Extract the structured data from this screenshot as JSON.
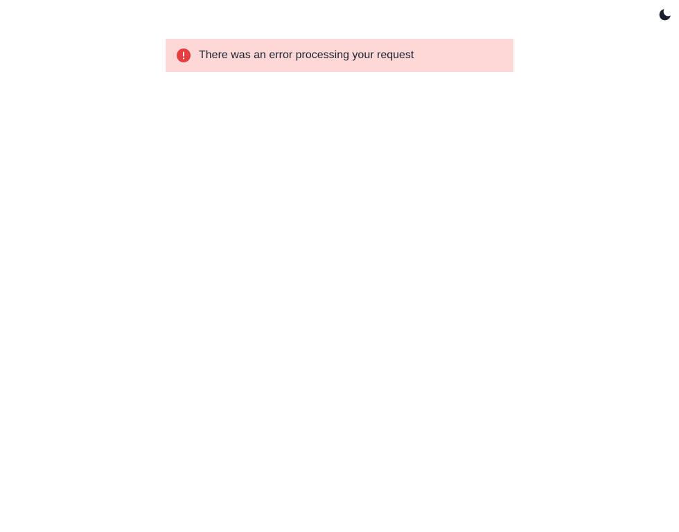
{
  "header": {
    "theme_toggle_icon": "moon-icon"
  },
  "alert": {
    "status": "error",
    "icon": "alert-circle-icon",
    "message": "There was an error processing your request"
  },
  "colors": {
    "alert_background": "#fed7d7",
    "alert_icon": "#e53e3e",
    "text": "#1a202c",
    "toggle_icon": "#1a202c"
  }
}
